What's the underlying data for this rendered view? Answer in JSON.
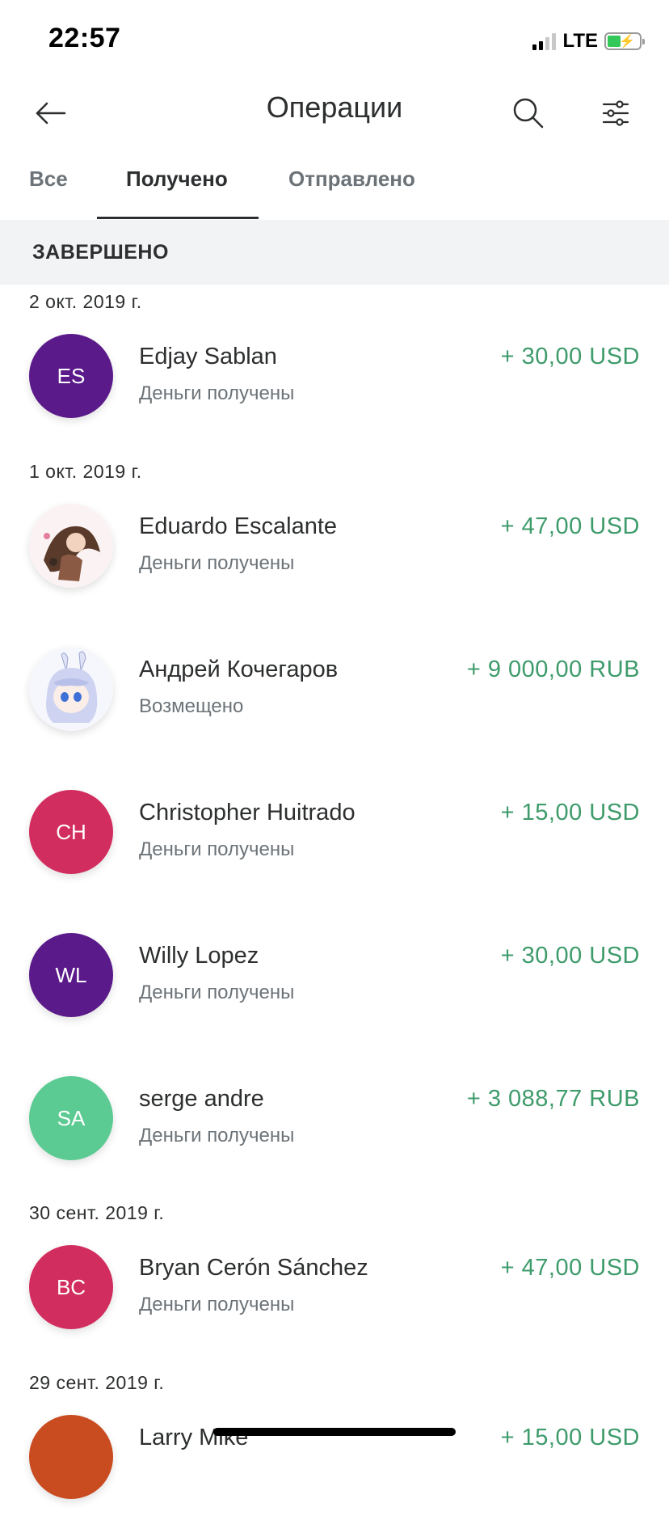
{
  "status_bar": {
    "time": "22:57",
    "network": "LTE"
  },
  "header": {
    "title": "Операции"
  },
  "tabs": [
    {
      "label": "Все",
      "active": false
    },
    {
      "label": "Получено",
      "active": true
    },
    {
      "label": "Отправлено",
      "active": false
    }
  ],
  "section": {
    "title": "ЗАВЕРШЕНО"
  },
  "dates": [
    "2 окт. 2019 г.",
    "1 окт. 2019 г.",
    "30 сент. 2019 г.",
    "29 сент. 2019 г."
  ],
  "transactions": [
    {
      "initials": "ES",
      "avatar_color": "#5b1a8a",
      "name": "Edjay Sablan",
      "status": "Деньги получены",
      "amount": "+ 30,00 USD"
    },
    {
      "initials": "",
      "avatar_color": "#ffffff",
      "name": "Eduardo Escalante",
      "status": "Деньги получены",
      "amount": "+ 47,00 USD"
    },
    {
      "initials": "",
      "avatar_color": "#ffffff",
      "name": "Андрей Кочегаров",
      "status": "Возмещено",
      "amount": "+ 9 000,00 RUB"
    },
    {
      "initials": "CH",
      "avatar_color": "#d12d5e",
      "name": "Christopher Huitrado",
      "status": "Деньги получены",
      "amount": "+ 15,00 USD"
    },
    {
      "initials": "WL",
      "avatar_color": "#5b1a8a",
      "name": "Willy Lopez",
      "status": "Деньги получены",
      "amount": "+ 30,00 USD"
    },
    {
      "initials": "SA",
      "avatar_color": "#5ccb93",
      "name": "serge andre",
      "status": "Деньги получены",
      "amount": "+ 3 088,77 RUB"
    },
    {
      "initials": "BC",
      "avatar_color": "#d12d5e",
      "name": "Bryan Cerón Sánchez",
      "status": "Деньги получены",
      "amount": "+ 47,00 USD"
    },
    {
      "initials": "",
      "avatar_color": "#c94b20",
      "name": "Larry Mike",
      "status": "",
      "amount": "+ 15,00 USD"
    }
  ],
  "colors": {
    "amount_positive": "#3e9b6b",
    "section_bg": "#f2f3f4",
    "text_primary": "#2c2e2f",
    "text_secondary": "#6c7378"
  },
  "icons": [
    "back-arrow-icon",
    "search-icon",
    "filter-sliders-icon"
  ]
}
